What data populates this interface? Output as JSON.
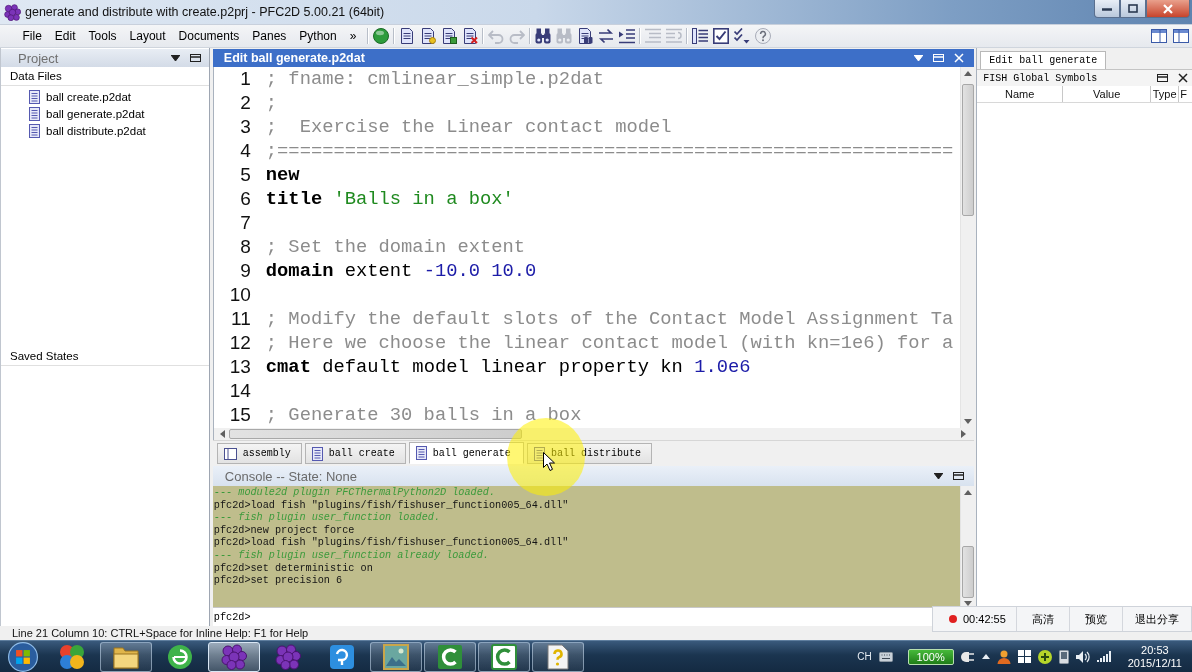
{
  "window": {
    "title": "generate and distribute with create.p2prj - PFC2D 5.00.21 (64bit)"
  },
  "menu": [
    "File",
    "Edit",
    "Tools",
    "Layout",
    "Documents",
    "Panes",
    "Python",
    "»"
  ],
  "toolbar_groups": [
    {
      "tools": [
        {
          "kind": "run",
          "disabled": false
        }
      ]
    },
    {
      "tools": [
        {
          "kind": "page",
          "disabled": false
        },
        {
          "kind": "page-new",
          "disabled": false
        },
        {
          "kind": "page-save",
          "disabled": false
        },
        {
          "kind": "page-close",
          "disabled": false
        }
      ]
    },
    {
      "tools": [
        {
          "kind": "undo",
          "disabled": true
        },
        {
          "kind": "redo",
          "disabled": true
        }
      ]
    },
    {
      "tools": [
        {
          "kind": "find",
          "disabled": false
        },
        {
          "kind": "find",
          "disabled": true
        },
        {
          "kind": "find-page",
          "disabled": false
        },
        {
          "kind": "replace",
          "disabled": false
        },
        {
          "kind": "indent",
          "disabled": false
        }
      ]
    },
    {
      "tools": [
        {
          "kind": "outdent",
          "disabled": true
        },
        {
          "kind": "uncomment",
          "disabled": true
        }
      ]
    },
    {
      "tools": [
        {
          "kind": "list",
          "disabled": false
        },
        {
          "kind": "check",
          "disabled": false
        },
        {
          "kind": "checks",
          "disabled": false
        },
        {
          "kind": "help",
          "disabled": false
        }
      ]
    }
  ],
  "project_panel": {
    "title": "Project",
    "sections": [
      {
        "title": "Data Files",
        "items": [
          {
            "label": "ball create.p2dat",
            "selected": false
          },
          {
            "label": "ball generate.p2dat",
            "selected": false
          },
          {
            "label": "ball distribute.p2dat",
            "selected": false
          }
        ]
      },
      {
        "title": "Saved States"
      }
    ]
  },
  "editor": {
    "title": "Edit ball generate.p2dat",
    "lines": [
      {
        "number": "1",
        "tokens": [
          {
            "kind": "comment",
            "text": "; fname: cmlinear_simple.p2dat"
          }
        ]
      },
      {
        "number": "2",
        "tokens": [
          {
            "kind": "comment",
            "text": ";"
          }
        ]
      },
      {
        "number": "3",
        "tokens": [
          {
            "kind": "comment",
            "text": ";  Exercise the Linear contact model"
          }
        ]
      },
      {
        "number": "4",
        "tokens": [
          {
            "kind": "comment",
            "text": ";============================================================"
          }
        ]
      },
      {
        "number": "5",
        "tokens": [
          {
            "kind": "keyword",
            "text": "new"
          }
        ]
      },
      {
        "number": "6",
        "tokens": [
          {
            "kind": "keyword",
            "text": "title"
          },
          {
            "kind": "string",
            "text": " 'Balls in a box'"
          }
        ]
      },
      {
        "number": "7"
      },
      {
        "number": "8",
        "tokens": [
          {
            "kind": "comment",
            "text": "; Set the domain extent"
          }
        ]
      },
      {
        "number": "9",
        "tokens": [
          {
            "kind": "keyword",
            "text": "domain"
          },
          {
            "kind": "plain",
            "text": " extent "
          },
          {
            "kind": "number",
            "text": "-10.0 10.0"
          }
        ]
      },
      {
        "number": "10"
      },
      {
        "number": "11",
        "tokens": [
          {
            "kind": "comment",
            "text": "; Modify the default slots of the Contact Model Assignment Ta"
          }
        ]
      },
      {
        "number": "12",
        "tokens": [
          {
            "kind": "comment",
            "text": "; Here we choose the linear contact model (with kn=1e6) for a"
          }
        ]
      },
      {
        "number": "13",
        "tokens": [
          {
            "kind": "keyword",
            "text": "cmat"
          },
          {
            "kind": "plain",
            "text": " default model linear property kn "
          },
          {
            "kind": "number",
            "text": "1.0e6"
          }
        ]
      },
      {
        "number": "14"
      },
      {
        "number": "15",
        "tokens": [
          {
            "kind": "comment",
            "text": "; Generate 30 balls in a box"
          }
        ]
      }
    ],
    "tabs": [
      {
        "label": "assembly",
        "kind": "assembly",
        "selected": false
      },
      {
        "label": "ball create",
        "kind": "data",
        "selected": false
      },
      {
        "label": "ball generate",
        "kind": "data",
        "selected": true
      },
      {
        "label": "ball distribute",
        "kind": "data",
        "selected": false
      }
    ]
  },
  "console": {
    "title": "Console -- State: None",
    "lines": [
      {
        "kind": "info",
        "text": "--- module2d plugin PFCThermalPython2D loaded."
      },
      {
        "kind": "command",
        "text": "pfc2d>load fish \"plugins/fish/fishuser_function005_64.dll\""
      },
      {
        "kind": "info",
        "text": "--- fish plugin user_function loaded."
      },
      {
        "kind": "command",
        "text": "pfc2d>new project force"
      },
      {
        "kind": "command",
        "text": "pfc2d>load fish \"plugins/fish/fishuser_function005_64.dll\""
      },
      {
        "kind": "info",
        "text": "--- fish plugin user_function already loaded."
      },
      {
        "kind": "command",
        "text": "pfc2d>set deterministic on"
      },
      {
        "kind": "command",
        "text": "pfc2d>set precision 6"
      }
    ],
    "prompt": "pfc2d>"
  },
  "symbols_panel": {
    "tab": "Edit ball generate",
    "title": "FISH Global Symbols",
    "columns": [
      "Name",
      "Value",
      "Type",
      "F"
    ]
  },
  "status_bar": "Line 21 Column 10: CTRL+Space for Inline Help: F1 for Help",
  "recording": {
    "time": "00:42:55",
    "buttons": [
      "高清",
      "预览",
      "退出分享"
    ]
  },
  "taskbar": {
    "apps": [
      {
        "kind": "pinwheel",
        "running": false,
        "selected": false
      },
      {
        "kind": "folder",
        "running": true,
        "selected": false
      },
      {
        "kind": "ring",
        "running": false,
        "selected": false
      },
      {
        "kind": "cluster",
        "running": true,
        "selected": true
      },
      {
        "kind": "cluster",
        "running": false,
        "selected": false
      },
      {
        "kind": "tile",
        "running": false,
        "selected": false
      },
      {
        "kind": "image",
        "running": true,
        "selected": false
      },
      {
        "kind": "recorder",
        "running": true,
        "selected": false
      },
      {
        "kind": "recorder-editor",
        "running": true,
        "selected": false
      },
      {
        "kind": "help",
        "running": true,
        "selected": false
      }
    ],
    "language": "CH",
    "battery": "100%",
    "time": "20:53",
    "date": "2015/12/11"
  }
}
